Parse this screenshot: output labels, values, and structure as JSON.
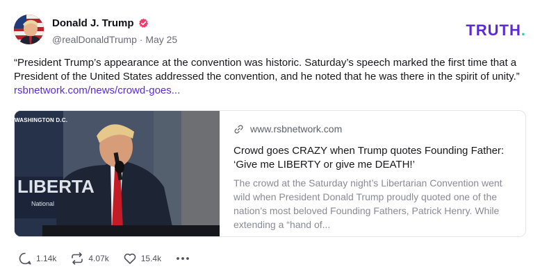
{
  "post": {
    "author_name": "Donald J. Trump",
    "handle": "@realDonaldTrump",
    "separator": "·",
    "date": "May 25",
    "text": "“President Trump’s appearance at the convention was historic. Saturday’s speech marked the first time that a President of the United States addressed the convention, and he noted that he was there in the spirit of unity.”",
    "link_text": "rsbnetwork.com/news/crowd-goes...",
    "icons": {
      "verified": "verified-badge-icon",
      "avatar": "avatar"
    }
  },
  "brand": {
    "name": "TRUTH",
    "dot": ".",
    "color": "#5b2bd6",
    "dot_color": "#1fd1b2"
  },
  "card": {
    "image_caption": "WASHINGTON D.C.",
    "domain": "www.rsbnetwork.com",
    "title": "Crowd goes CRAZY when Trump quotes Founding Father: ‘Give me LIBERTY or give me DEATH!’",
    "description": "The crowd at the Saturday night’s Libertarian Convention went wild when President Donald Trump proudly quoted one of the nation’s most beloved Founding Fathers, Patrick Henry. While extending a “hand of...",
    "icon": "link-icon"
  },
  "actions": {
    "replies": "1.14k",
    "retruths": "4.07k",
    "likes": "15.4k",
    "icons": [
      "reply-icon",
      "retruth-icon",
      "like-icon",
      "more-icon"
    ]
  }
}
